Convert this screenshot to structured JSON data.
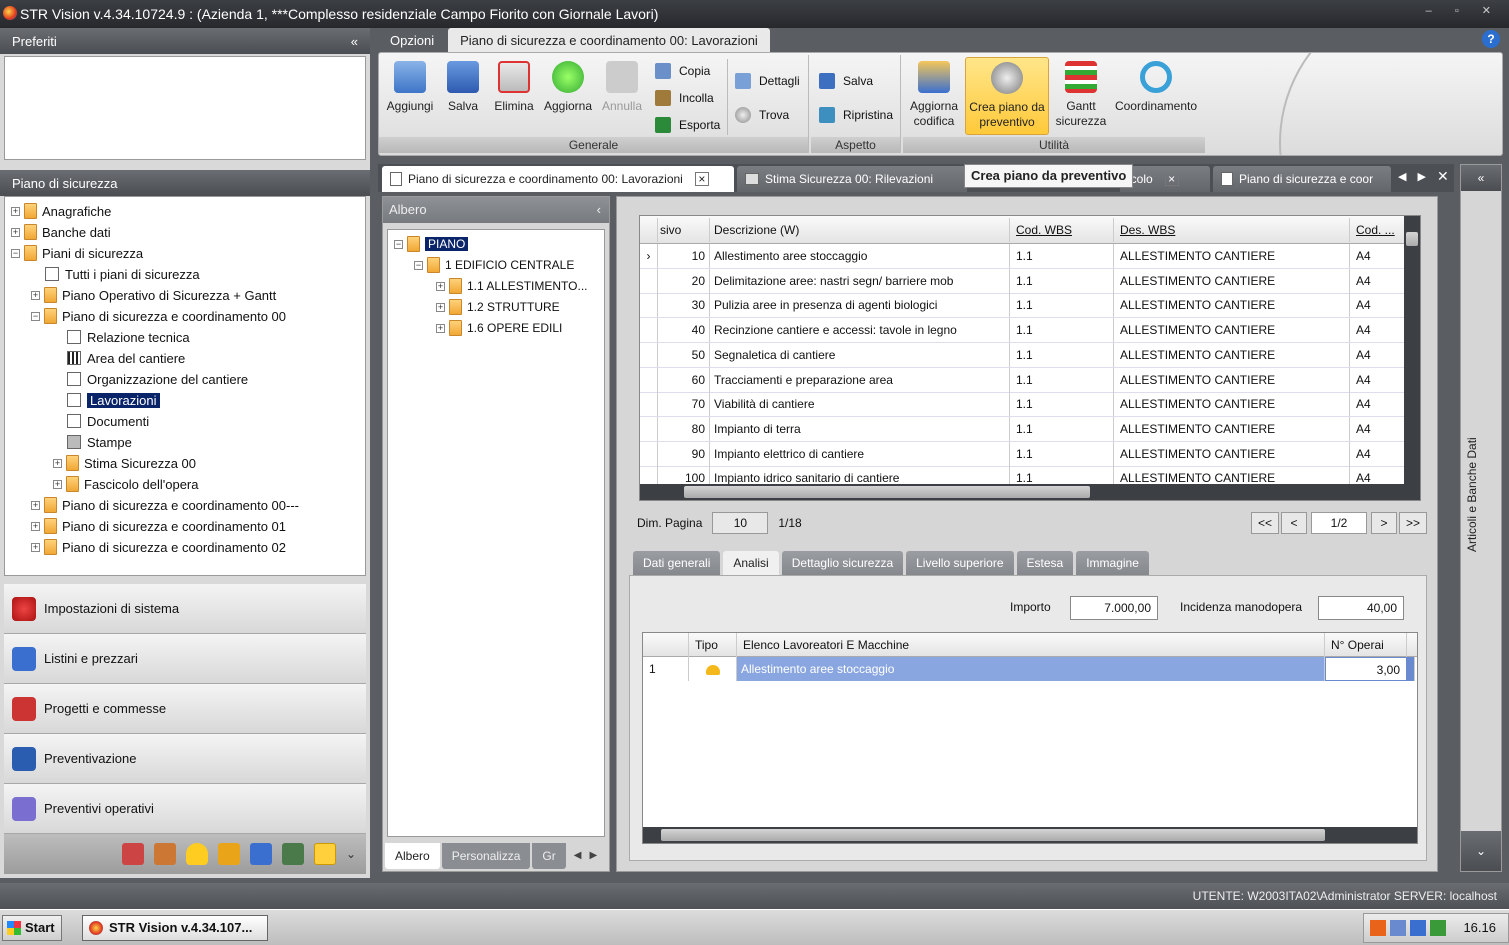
{
  "window": {
    "title": "STR Vision v.4.34.10724.9 : (Azienda 1, ***Complesso residenziale Campo Fiorito con Giornale Lavori)"
  },
  "left": {
    "preferiti_title": "Preferiti",
    "piano_title": "Piano di sicurezza",
    "tree": [
      "Anagrafiche",
      "Banche dati",
      "Piani di sicurezza",
      "Tutti i piani di sicurezza",
      "Piano Operativo di Sicurezza + Gantt",
      "Piano di sicurezza e coordinamento 00",
      "Relazione tecnica",
      "Area del cantiere",
      "Organizzazione del cantiere",
      "Lavorazioni",
      "Documenti",
      "Stampe",
      "Stima Sicurezza 00",
      "Fascicolo dell'opera",
      "Piano di sicurezza e coordinamento 00---",
      "Piano di sicurezza e coordinamento 01",
      "Piano di sicurezza e coordinamento 02"
    ],
    "nav": [
      "Impostazioni di sistema",
      "Listini e prezzari",
      "Progetti e commesse",
      "Preventivazione",
      "Preventivi operativi"
    ]
  },
  "ribbon": {
    "tabs": [
      "Opzioni",
      "Piano di sicurezza e coordinamento 00: Lavorazioni"
    ],
    "aggiungi": "Aggiungi",
    "salva": "Salva",
    "elimina": "Elimina",
    "aggiorna": "Aggiorna",
    "annulla": "Annulla",
    "copia": "Copia",
    "incolla": "Incolla",
    "esporta": "Esporta",
    "dettagli": "Dettagli",
    "trova": "Trova",
    "generale": "Generale",
    "salva2": "Salva",
    "ripristina": "Ripristina",
    "aspetto": "Aspetto",
    "aggiorna_codifica_1": "Aggiorna",
    "aggiorna_codifica_2": "codifica",
    "crea_1": "Crea piano da",
    "crea_2": "preventivo",
    "gantt_1": "Gantt",
    "gantt_2": "sicurezza",
    "coordinamento": "Coordinamento",
    "utilita": "Utilità"
  },
  "doctabs": [
    "Piano di sicurezza e coordinamento 00: Lavorazioni",
    "Stima Sicurezza 00: Rilevazioni",
    "icolo",
    "Piano di sicurezza e coor"
  ],
  "tooltip": "Crea piano da preventivo",
  "albero": {
    "title": "Albero",
    "nodes": [
      "PIANO",
      "1 EDIFICIO CENTRALE",
      "1.1 ALLESTIMENTO...",
      "1.2 STRUTTURE",
      "1.6 OPERE EDILI"
    ],
    "tabs": [
      "Albero",
      "Personalizza",
      "Gr"
    ]
  },
  "grid": {
    "headers": [
      "sivo",
      "Descrizione (W)",
      "Cod. WBS",
      "Des. WBS",
      "Cod. ..."
    ],
    "rows": [
      [
        "10",
        "Allestimento aree stoccaggio",
        "1.1",
        "ALLESTIMENTO CANTIERE",
        "A4"
      ],
      [
        "20",
        "Delimitazione aree: nastri segn/ barriere mob",
        "1.1",
        "ALLESTIMENTO CANTIERE",
        "A4"
      ],
      [
        "30",
        "Pulizia aree in presenza di agenti biologici",
        "1.1",
        "ALLESTIMENTO CANTIERE",
        "A4"
      ],
      [
        "40",
        "Recinzione cantiere e accessi: tavole in legno",
        "1.1",
        "ALLESTIMENTO CANTIERE",
        "A4"
      ],
      [
        "50",
        "Segnaletica di cantiere",
        "1.1",
        "ALLESTIMENTO CANTIERE",
        "A4"
      ],
      [
        "60",
        "Tracciamenti e preparazione area",
        "1.1",
        "ALLESTIMENTO CANTIERE",
        "A4"
      ],
      [
        "70",
        "Viabilità di cantiere",
        "1.1",
        "ALLESTIMENTO CANTIERE",
        "A4"
      ],
      [
        "80",
        "Impianto di terra",
        "1.1",
        "ALLESTIMENTO CANTIERE",
        "A4"
      ],
      [
        "90",
        "Impianto elettrico di cantiere",
        "1.1",
        "ALLESTIMENTO CANTIERE",
        "A4"
      ],
      [
        "100",
        "Impianto idrico sanitario di cantiere",
        "1.1",
        "ALLESTIMENTO CANTIERE",
        "A4"
      ]
    ],
    "dim_label": "Dim. Pagina",
    "dim_value": "10",
    "pages": "1/18",
    "page_current": "1/2"
  },
  "bottom": {
    "tabs": [
      "Dati generali",
      "Analisi",
      "Dettaglio sicurezza",
      "Livello superiore",
      "Estesa",
      "Immagine"
    ],
    "importo_label": "Importo",
    "importo": "7.000,00",
    "incidenza_label": "Incidenza manodopera",
    "incidenza": "40,00",
    "headers": [
      "Tipo",
      "Elenco Lavoreatori E Macchine",
      "N° Operai"
    ],
    "row": {
      "n": "1",
      "desc": "Allestimento aree stoccaggio",
      "operai": "3,00"
    }
  },
  "right_strip": "Articoli e Banche Dati",
  "status": "UTENTE: W2003ITA02\\Administrator   SERVER: localhost",
  "taskbar": {
    "start": "Start",
    "item": "STR Vision v.4.34.107...",
    "clock": "16.16"
  }
}
